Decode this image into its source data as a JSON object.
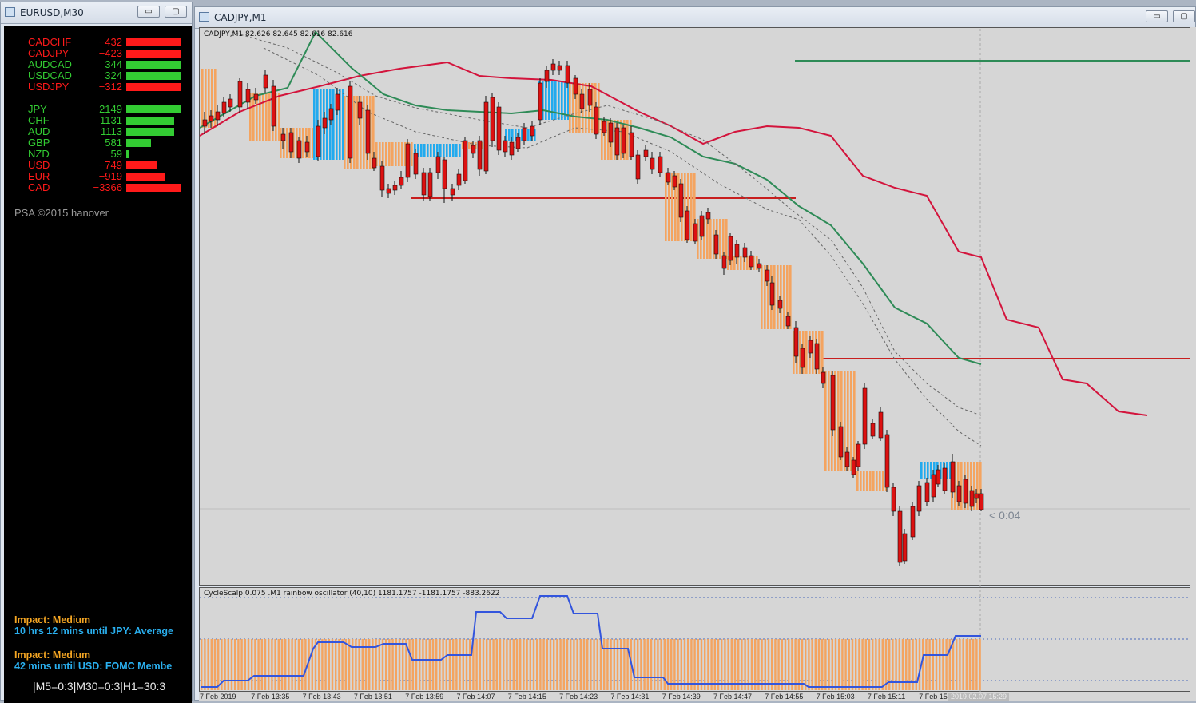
{
  "window_left": {
    "title": "EURUSD,M30",
    "pairs": [
      {
        "name": "CADCHF",
        "value": "-432",
        "color": "#ff1a1a",
        "bar": 1.0
      },
      {
        "name": "CADJPY",
        "value": "-423",
        "color": "#ff1a1a",
        "bar": 1.0
      },
      {
        "name": "AUDCAD",
        "value": "344",
        "color": "#33cc33",
        "bar": 1.0
      },
      {
        "name": "USDCAD",
        "value": "324",
        "color": "#33cc33",
        "bar": 1.0
      },
      {
        "name": "USDJPY",
        "value": "-312",
        "color": "#ff1a1a",
        "bar": 1.0
      }
    ],
    "currencies": [
      {
        "name": "JPY",
        "value": "2149",
        "color": "#33cc33",
        "bar": 1.0
      },
      {
        "name": "CHF",
        "value": "1131",
        "color": "#33cc33",
        "bar": 0.88
      },
      {
        "name": "AUD",
        "value": "1113",
        "color": "#33cc33",
        "bar": 0.88
      },
      {
        "name": "GBP",
        "value": "581",
        "color": "#33cc33",
        "bar": 0.45
      },
      {
        "name": "NZD",
        "value": "59",
        "color": "#33cc33",
        "bar": 0.03
      },
      {
        "name": "USD",
        "value": "-749",
        "color": "#ff1a1a",
        "bar": 0.58
      },
      {
        "name": "EUR",
        "value": "-919",
        "color": "#ff1a1a",
        "bar": 0.72
      },
      {
        "name": "CAD",
        "value": "-3366",
        "color": "#ff1a1a",
        "bar": 1.0
      }
    ],
    "credit": "PSA ©2015 hanover",
    "news1_impact": "Impact: Medium",
    "news1_text": "10 hrs 12 mins until JPY: Average",
    "news2_impact": "Impact: Medium",
    "news2_text": "42 mins until USD: FOMC Membe",
    "timeframes": "|M5=0:3|M30=0:3|H1=30:3"
  },
  "window_main": {
    "title": "CADJPY,M1",
    "ohlc_header": "CADJPY,M1  82.626 82.645 82.616 82.616",
    "countdown": "< 0:04",
    "osc_header": "CycleScalp 0.075 .M1 rainbow oscillator (40,10) 1181.1757 -1181.1757 -883.2622",
    "x_labels": [
      "7 Feb 2019",
      "7 Feb 13:35",
      "7 Feb 13:43",
      "7 Feb 13:51",
      "7 Feb 13:59",
      "7 Feb 14:07",
      "7 Feb 14:15",
      "7 Feb 14:23",
      "7 Feb 14:31",
      "7 Feb 14:39",
      "7 Feb 14:47",
      "7 Feb 14:55",
      "7 Feb 15:03",
      "7 Feb 15:11",
      "7 Feb 15:"
    ],
    "x_last_label": "2019.02.07 15:29"
  },
  "buttons": {
    "minimize": "▭",
    "restore": "▢"
  },
  "colors": {
    "bull": "#22dd22",
    "bear": "#dd1111",
    "orange": "#f4a460",
    "blue": "#22aaee",
    "ma_red": "#d3143c",
    "ma_green": "#2e8b57",
    "osc_line": "#3355dd"
  }
}
